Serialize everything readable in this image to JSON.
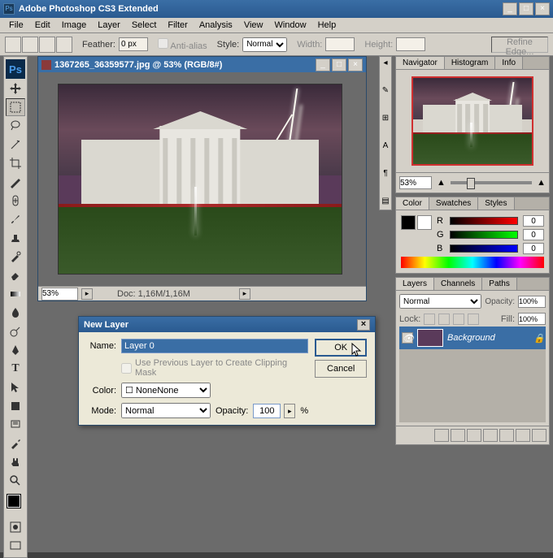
{
  "app": {
    "title": "Adobe Photoshop CS3 Extended"
  },
  "menu": [
    "File",
    "Edit",
    "Image",
    "Layer",
    "Select",
    "Filter",
    "Analysis",
    "View",
    "Window",
    "Help"
  ],
  "options": {
    "feather_label": "Feather:",
    "feather_value": "0 px",
    "antialias": "Anti-alias",
    "style_label": "Style:",
    "style_value": "Normal",
    "width_label": "Width:",
    "height_label": "Height:",
    "refine": "Refine Edge..."
  },
  "doc": {
    "title": "1367265_36359577.jpg @ 53% (RGB/8#)",
    "zoom": "53%",
    "info": "Doc: 1,16M/1,16M"
  },
  "dialog": {
    "title": "New Layer",
    "name_label": "Name:",
    "name_value": "Layer 0",
    "clip": "Use Previous Layer to Create Clipping Mask",
    "color_label": "Color:",
    "color_value": "None",
    "mode_label": "Mode:",
    "mode_value": "Normal",
    "opacity_label": "Opacity:",
    "opacity_value": "100",
    "pct": "%",
    "ok": "OK",
    "cancel": "Cancel"
  },
  "nav": {
    "tabs": [
      "Navigator",
      "Histogram",
      "Info"
    ],
    "zoom": "53%"
  },
  "color": {
    "tabs": [
      "Color",
      "Swatches",
      "Styles"
    ],
    "r": "R",
    "g": "G",
    "b": "B",
    "rv": "0",
    "gv": "0",
    "bv": "0"
  },
  "layers": {
    "tabs": [
      "Layers",
      "Channels",
      "Paths"
    ],
    "blend": "Normal",
    "opacity_label": "Opacity:",
    "opacity": "100%",
    "lock_label": "Lock:",
    "fill_label": "Fill:",
    "fill": "100%",
    "bg_layer": "Background"
  }
}
